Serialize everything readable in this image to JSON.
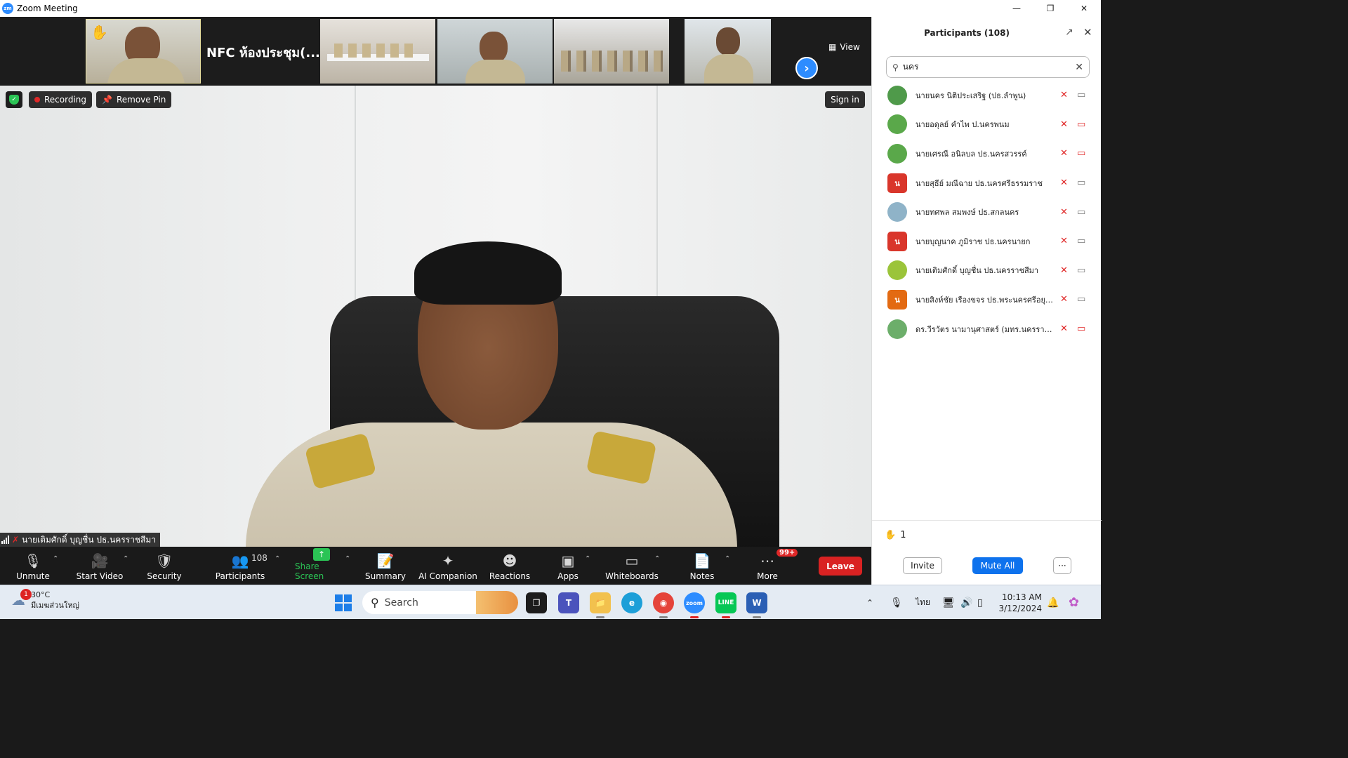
{
  "window": {
    "title": "Zoom Meeting",
    "logo_text": "zm"
  },
  "strip": {
    "room_title": "NFC ห้องประชุม(...",
    "view_label": "View"
  },
  "overlay": {
    "recording_label": "Recording",
    "remove_pin_label": "Remove Pin",
    "sign_in_label": "Sign in",
    "active_speaker_name": "นายเติมศักดิ์ บุญชื่น ปธ.นครราชสีมา"
  },
  "toolbar": {
    "unmute_label": "Unmute",
    "start_video_label": "Start Video",
    "security_label": "Security",
    "participants_label": "Participants",
    "participants_count": "108",
    "share_label": "Share Screen",
    "summary_label": "Summary",
    "ai_label": "AI Companion",
    "reactions_label": "Reactions",
    "apps_label": "Apps",
    "whiteboards_label": "Whiteboards",
    "notes_label": "Notes",
    "more_label": "More",
    "more_badge": "99+",
    "leave_label": "Leave"
  },
  "panel": {
    "title": "Participants (108)",
    "search_value": "นคร",
    "participants": [
      {
        "name": "นายนคร นิติประเสริฐ (ปธ.ลำพูน)",
        "avatar_text": "",
        "avatar_color": "#4f9a4a",
        "camera_off": false
      },
      {
        "name": "นายอดุลย์ คำไพ ป.นครพนม",
        "avatar_text": "",
        "avatar_color": "#5aa84a",
        "camera_off": true
      },
      {
        "name": "นายเศรณี อนิลบล ปธ.นครสวรรค์",
        "avatar_text": "",
        "avatar_color": "#5aa84a",
        "camera_off": true
      },
      {
        "name": "นายสุธีย์  มณีฉาย ปธ.นครศรีธรรมราช",
        "avatar_text": "น",
        "avatar_color": "#d9362b",
        "camera_off": false
      },
      {
        "name": "นายทศพล  สมพงษ์ ปธ.สกลนคร",
        "avatar_text": "",
        "avatar_color": "#8fb3c8",
        "camera_off": false
      },
      {
        "name": "นายบุญนาค  ภูมิราช ปธ.นครนายก",
        "avatar_text": "น",
        "avatar_color": "#d9362b",
        "camera_off": false
      },
      {
        "name": "นายเติมศักดิ์ บุญชื่น ปธ.นครราชสีมา",
        "avatar_text": "",
        "avatar_color": "#9bc43a",
        "camera_off": false
      },
      {
        "name": "นายสิงห์ชัย เรืองขจร ปธ.พระนครศรีอยุธ...",
        "avatar_text": "น",
        "avatar_color": "#e36a12",
        "camera_off": false
      },
      {
        "name": "ดร.วีรวัตร นามานุศาสตร์ (มทร.นครราช...",
        "avatar_text": "",
        "avatar_color": "#6cae6a",
        "camera_off": true
      }
    ],
    "raised_hands_count": "1",
    "invite_label": "Invite",
    "mute_all_label": "Mute All",
    "more_label": "···"
  },
  "taskbar": {
    "weather_temp": "30°C",
    "weather_desc": "มีเมฆส่วนใหญ่",
    "weather_badge": "1",
    "search_placeholder": "Search",
    "language": "ไทย",
    "time": "10:13 AM",
    "date": "3/12/2024"
  },
  "colors": {
    "accent": "#2d8cff",
    "leave": "#d92222",
    "share": "#2bc455",
    "mute_all": "#0e72ed"
  }
}
